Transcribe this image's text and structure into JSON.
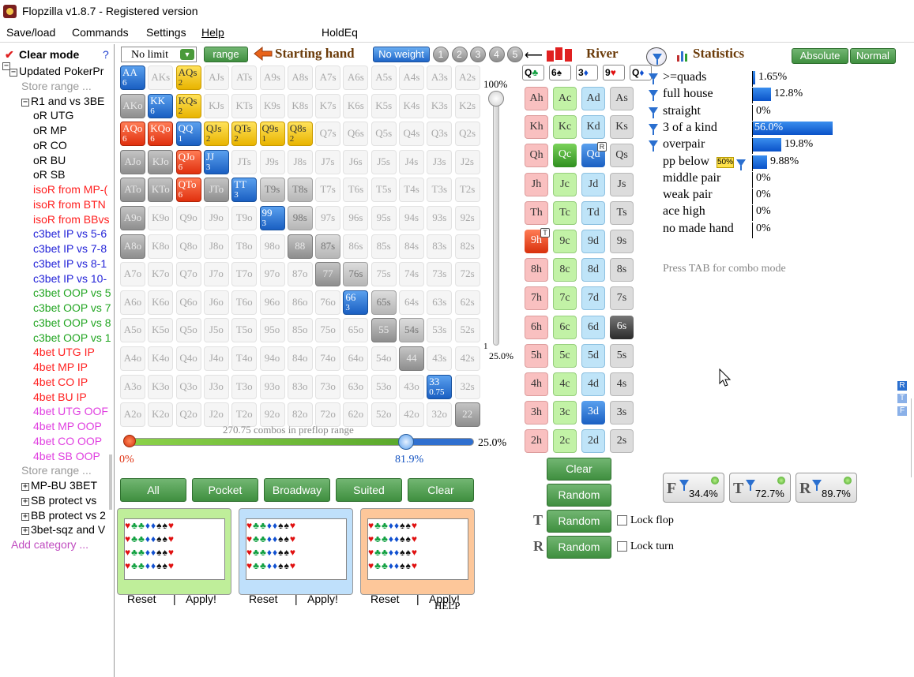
{
  "window": {
    "title": "Flopzilla v1.8.7 - Registered version"
  },
  "menu": [
    "Save/load",
    "Commands",
    "Settings",
    "Help",
    "HoldEq"
  ],
  "left_panel": {
    "clear_mode": "Clear mode",
    "help_mark": "?",
    "tree": [
      {
        "text": "Updated PokerPr",
        "color": "black",
        "pm": "−"
      },
      {
        "text": "Store range ...",
        "color": "gray"
      },
      {
        "text": "R1 and vs 3BE",
        "color": "black",
        "pm": "−"
      },
      {
        "text": "oR UTG",
        "color": "black"
      },
      {
        "text": "oR MP",
        "color": "black"
      },
      {
        "text": "oR CO",
        "color": "black"
      },
      {
        "text": "oR BU",
        "color": "black"
      },
      {
        "text": "oR SB",
        "color": "black"
      },
      {
        "text": "isoR from MP-(",
        "color": "red"
      },
      {
        "text": "isoR from BTN",
        "color": "red"
      },
      {
        "text": "isoR from BBvs",
        "color": "red"
      },
      {
        "text": "c3bet IP vs 5-6",
        "color": "blue"
      },
      {
        "text": "c3bet IP vs 7-8",
        "color": "blue"
      },
      {
        "text": "c3bet IP vs 8-1",
        "color": "blue"
      },
      {
        "text": "c3bet IP vs 10-",
        "color": "blue"
      },
      {
        "text": "c3bet OOP vs 5",
        "color": "green"
      },
      {
        "text": "c3bet OOP vs 7",
        "color": "green"
      },
      {
        "text": "c3bet OOP vs 8",
        "color": "green"
      },
      {
        "text": "c3bet OOP vs 1",
        "color": "green"
      },
      {
        "text": "4bet UTG IP",
        "color": "red"
      },
      {
        "text": "4bet MP IP",
        "color": "red"
      },
      {
        "text": "4bet CO IP",
        "color": "red"
      },
      {
        "text": "4bet BU IP",
        "color": "red"
      },
      {
        "text": "4bet UTG OOF",
        "color": "mag"
      },
      {
        "text": "4bet MP OOP",
        "color": "mag"
      },
      {
        "text": "4bet CO OOP",
        "color": "mag"
      },
      {
        "text": "4bet SB OOP",
        "color": "mag"
      },
      {
        "text": "Store range ...",
        "color": "gray"
      },
      {
        "text": "MP-BU 3BET",
        "color": "black",
        "pm": "+"
      },
      {
        "text": "SB protect vs",
        "color": "black",
        "pm": "+"
      },
      {
        "text": "BB protect vs 2",
        "color": "black",
        "pm": "+"
      },
      {
        "text": "3bet-sqz and V",
        "color": "black",
        "pm": "+"
      },
      {
        "text": "Add category ...",
        "color": "pink"
      }
    ]
  },
  "toolbar": {
    "limit_select": "No limit",
    "range_btn": "range",
    "starting_hand": "Starting hand",
    "no_weight": "No weight",
    "weights": [
      "1",
      "2",
      "3",
      "4",
      "5"
    ],
    "river": "River",
    "statistics": "Statistics",
    "absolute": "Absolute",
    "normal": "Normal"
  },
  "hand_grid": [
    [
      "AA",
      "AKs",
      "AQs",
      "AJs",
      "ATs",
      "A9s",
      "A8s",
      "A7s",
      "A6s",
      "A5s",
      "A4s",
      "A3s",
      "A2s"
    ],
    [
      "AKo",
      "KK",
      "KQs",
      "KJs",
      "KTs",
      "K9s",
      "K8s",
      "K7s",
      "K6s",
      "K5s",
      "K4s",
      "K3s",
      "K2s"
    ],
    [
      "AQo",
      "KQo",
      "QQ",
      "QJs",
      "QTs",
      "Q9s",
      "Q8s",
      "Q7s",
      "Q6s",
      "Q5s",
      "Q4s",
      "Q3s",
      "Q2s"
    ],
    [
      "AJo",
      "KJo",
      "QJo",
      "JJ",
      "JTs",
      "J9s",
      "J8s",
      "J7s",
      "J6s",
      "J5s",
      "J4s",
      "J3s",
      "J2s"
    ],
    [
      "ATo",
      "KTo",
      "QTo",
      "JTo",
      "TT",
      "T9s",
      "T8s",
      "T7s",
      "T6s",
      "T5s",
      "T4s",
      "T3s",
      "T2s"
    ],
    [
      "A9o",
      "K9o",
      "Q9o",
      "J9o",
      "T9o",
      "99",
      "98s",
      "97s",
      "96s",
      "95s",
      "94s",
      "93s",
      "92s"
    ],
    [
      "A8o",
      "K8o",
      "Q8o",
      "J8o",
      "T8o",
      "98o",
      "88",
      "87s",
      "86s",
      "85s",
      "84s",
      "83s",
      "82s"
    ],
    [
      "A7o",
      "K7o",
      "Q7o",
      "J7o",
      "T7o",
      "97o",
      "87o",
      "77",
      "76s",
      "75s",
      "74s",
      "73s",
      "72s"
    ],
    [
      "A6o",
      "K6o",
      "Q6o",
      "J6o",
      "T6o",
      "96o",
      "86o",
      "76o",
      "66",
      "65s",
      "64s",
      "63s",
      "62s"
    ],
    [
      "A5o",
      "K5o",
      "Q5o",
      "J5o",
      "T5o",
      "95o",
      "85o",
      "75o",
      "65o",
      "55",
      "54s",
      "53s",
      "52s"
    ],
    [
      "A4o",
      "K4o",
      "Q4o",
      "J4o",
      "T4o",
      "94o",
      "84o",
      "74o",
      "64o",
      "54o",
      "44",
      "43s",
      "42s"
    ],
    [
      "A3o",
      "K3o",
      "Q3o",
      "J3o",
      "T3o",
      "93o",
      "83o",
      "73o",
      "63o",
      "53o",
      "43o",
      "33",
      "32s"
    ],
    [
      "A2o",
      "K2o",
      "Q2o",
      "J2o",
      "T2o",
      "92o",
      "82o",
      "72o",
      "62o",
      "52o",
      "42o",
      "32o",
      "22"
    ]
  ],
  "hand_styles": {
    "AA": "blue:6",
    "AKo": "gray",
    "KK": "blue:6",
    "AQs": "yellow:2",
    "KQs": "yellow:2",
    "AQo": "red:6",
    "KQo": "red:6",
    "QQ": "blue:1",
    "QJs": "yellow:2",
    "QTs": "yellow:2",
    "Q9s": "yellow:1",
    "Q8s": "yellow:2",
    "AJo": "gray",
    "KJo": "gray",
    "QJo": "red:6",
    "JJ": "blue:3",
    "ATo": "gray",
    "KTo": "gray",
    "QTo": "red:6",
    "JTo": "gray",
    "TT": "blue:3",
    "T9s": "lgray",
    "T8s": "lgray",
    "A9o": "gray",
    "99": "blue:3",
    "98s": "lgray",
    "A8o": "gray",
    "88": "gray",
    "87s": "lgray",
    "77": "gray",
    "76s": "lgray",
    "66": "blue:3",
    "65s": "lgray",
    "55": "gray",
    "54s": "lgray",
    "44": "gray",
    "33": "blue:0.75",
    "22": "gray"
  },
  "slider": {
    "top_pct": "100%",
    "bottom_pct": "25.0%",
    "bottom_mark": "1",
    "combos_text": "270.75 combos in preflop range",
    "h_left": "0%",
    "h_mid": "81.9%",
    "h_right": "25.0%"
  },
  "range_buttons": [
    "All",
    "Pocket",
    "Broadway",
    "Suited",
    "Clear"
  ],
  "suit_panels": [
    {
      "color": "#bfee9a",
      "reset": "Reset",
      "apply": "Apply!"
    },
    {
      "color": "#bfe0fb",
      "reset": "Reset",
      "apply": "Apply!"
    },
    {
      "color": "#fdc79a",
      "reset": "Reset",
      "apply": "Apply!"
    }
  ],
  "help": "HELP",
  "flop": [
    "Q",
    "6",
    "3",
    "9",
    "Q"
  ],
  "board_ranks": [
    "A",
    "K",
    "Q",
    "J",
    "T",
    "9",
    "8",
    "7",
    "6",
    "5",
    "4",
    "3",
    "2"
  ],
  "board_selected": {
    "Qc": "csel",
    "Qd": "dsel",
    "9h": "hsel",
    "6s": "ssel",
    "3d": "dsel"
  },
  "board_tags": {
    "Qd": "R",
    "9h": "T"
  },
  "board_buttons": {
    "clear": "Clear",
    "random": "Random",
    "random_t": "Random",
    "random_r": "Random",
    "lock_flop": "Lock flop",
    "lock_turn": "Lock turn",
    "t_label": "T",
    "r_label": "R"
  },
  "statistics": [
    {
      "label": ">=quads",
      "value": "1.65%",
      "bar": 1.65,
      "funnel": true
    },
    {
      "label": "full house",
      "value": "12.8%",
      "bar": 12.8,
      "funnel": true
    },
    {
      "label": "straight",
      "value": "0%",
      "bar": 0,
      "funnel": true
    },
    {
      "label": "3 of a kind",
      "value": "56.0%",
      "bar": 56.0,
      "funnel": true,
      "inside": true
    },
    {
      "label": "overpair",
      "value": "19.8%",
      "bar": 19.8,
      "funnel": true
    },
    {
      "label": "pp below",
      "value": "9.88%",
      "bar": 9.88,
      "badge": "50%"
    },
    {
      "label": "middle pair",
      "value": "0%",
      "bar": 0
    },
    {
      "label": "weak pair",
      "value": "0%",
      "bar": 0
    },
    {
      "label": "ace high",
      "value": "0%",
      "bar": 0
    },
    {
      "label": "no made hand",
      "value": "0%",
      "bar": 0
    }
  ],
  "stats_hint": "Press TAB for combo mode",
  "filter_buttons": [
    {
      "letter": "F",
      "value": "34.4%"
    },
    {
      "letter": "T",
      "value": "72.7%"
    },
    {
      "letter": "R",
      "value": "89.7%"
    }
  ],
  "side_rtf": [
    "R",
    "T",
    "F"
  ]
}
